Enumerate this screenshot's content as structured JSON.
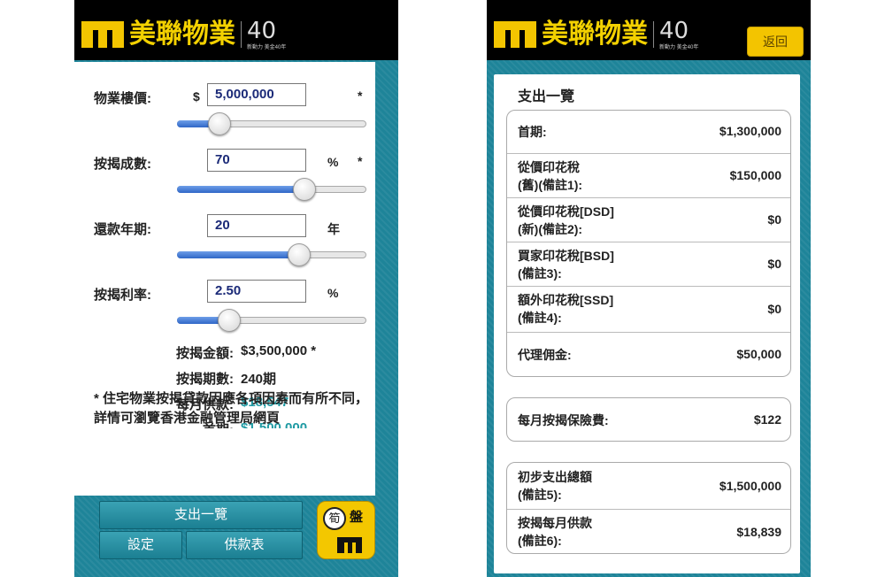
{
  "header": {
    "brand": "美聯物業",
    "anniversary_number": "40",
    "anniversary_sub": "新動力 美金40年"
  },
  "left": {
    "fields": [
      {
        "label": "物業樓價:",
        "prefix": "$",
        "value": "5,000,000",
        "suffix": "",
        "required": "*",
        "level": 0.22
      },
      {
        "label": "按揭成數:",
        "prefix": "",
        "value": "70",
        "suffix": "%",
        "required": "*",
        "level": 0.67
      },
      {
        "label": "還款年期:",
        "prefix": "",
        "value": "20",
        "suffix": "年",
        "required": "",
        "level": 0.64
      },
      {
        "label": "按揭利率:",
        "prefix": "",
        "value": "2.50",
        "suffix": "%",
        "required": "",
        "level": 0.27
      }
    ],
    "summary": [
      {
        "label": "按揭金額:",
        "value": "$3,500,000 *",
        "color": "#222222"
      },
      {
        "label": "按揭期數:",
        "value": "240期",
        "color": "#222222"
      },
      {
        "label": "每月供款:",
        "value": "$18,547",
        "color": "#1f9aa3"
      },
      {
        "label": "首期:",
        "value": "$1,500,000",
        "color": "#1f9aa3"
      }
    ],
    "note": "* 住宅物業按揭貸款因應各項因素而有所不同，詳情可瀏覽香港金融管理局網頁",
    "buttons": {
      "expenses": "支出一覽",
      "settings": "設定",
      "schedule": "供款表"
    },
    "app_icon": {
      "left_char": "筍",
      "right_char": "盤"
    }
  },
  "right": {
    "back_label": "返回",
    "title": "支出一覽",
    "groups": [
      {
        "items": [
          {
            "label_lines": [
              "首期:"
            ],
            "value": "$1,300,000"
          },
          {
            "label_lines": [
              "從價印花稅",
              "(舊)(備註1):"
            ],
            "value": "$150,000"
          },
          {
            "label_lines": [
              "從價印花稅[DSD]",
              "(新)(備註2):"
            ],
            "value": "$0"
          },
          {
            "label_lines": [
              "買家印花稅[BSD]",
              "(備註3):"
            ],
            "value": "$0"
          },
          {
            "label_lines": [
              "額外印花稅[SSD]",
              "(備註4):"
            ],
            "value": "$0"
          },
          {
            "label_lines": [
              "代理佣金:"
            ],
            "value": "$50,000"
          }
        ]
      },
      {
        "items": [
          {
            "label_lines": [
              "每月按揭保險費:"
            ],
            "value": "$122"
          }
        ]
      },
      {
        "items": [
          {
            "label_lines": [
              "初步支出總額",
              "(備註5):"
            ],
            "value": "$1,500,000"
          },
          {
            "label_lines": [
              "按揭每月供款",
              "(備註6):"
            ],
            "value": "$18,839"
          }
        ]
      }
    ]
  }
}
